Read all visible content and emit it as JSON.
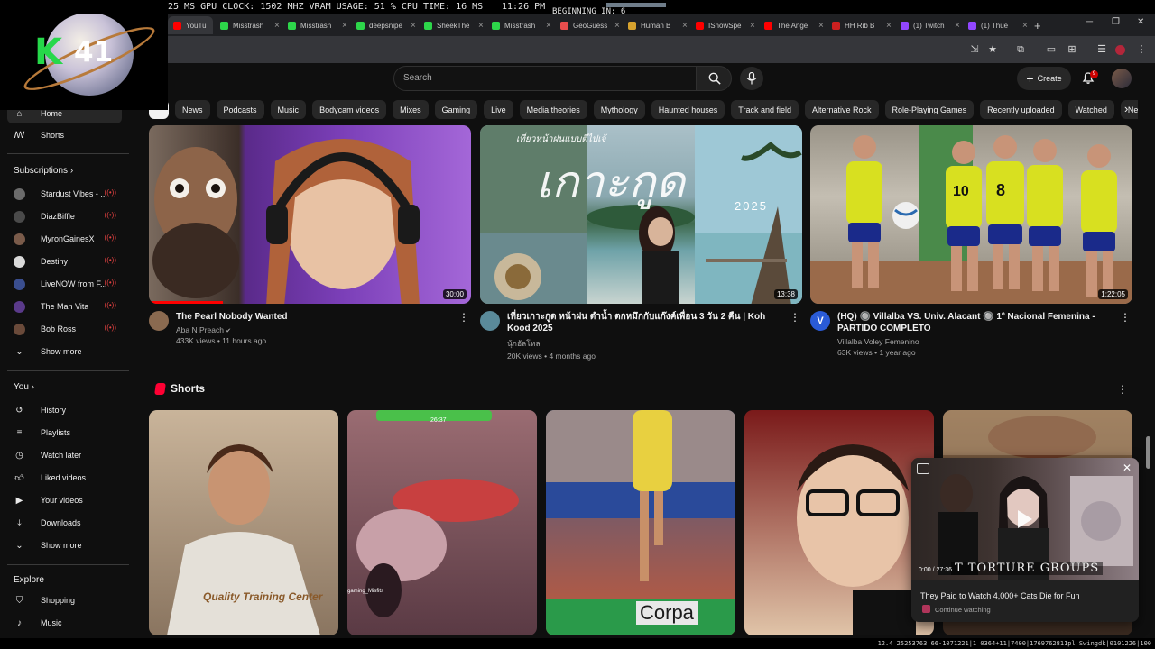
{
  "overlay": {
    "stats": "25 MS  GPU CLOCK: 1502 MHZ  VRAM USAGE: 51 %  CPU TIME: 16 MS",
    "clock": "11:26 PM",
    "beginning": "BEGINNING IN: 6",
    "badge_number": "41",
    "footer": "12.4 25253763|66-1071221|1 0364+11|7400|1769762811pl Swingdk|0101226|100"
  },
  "browser": {
    "tabs": [
      {
        "label": "YouTu",
        "color": "#ff0000",
        "active": true
      },
      {
        "label": "Misstrash",
        "color": "#2dd64a"
      },
      {
        "label": "Misstrash",
        "color": "#2dd64a"
      },
      {
        "label": "deepsnipe",
        "color": "#2dd64a"
      },
      {
        "label": "SheekThe",
        "color": "#2dd64a"
      },
      {
        "label": "Misstrash",
        "color": "#2dd64a"
      },
      {
        "label": "GeoGuess",
        "color": "#e84d4d"
      },
      {
        "label": "Human B",
        "color": "#d6a22e"
      },
      {
        "label": "IShowSpe",
        "color": "#ff0000"
      },
      {
        "label": "The Ange",
        "color": "#ff0000"
      },
      {
        "label": "HH Rib B",
        "color": "#cc2020"
      },
      {
        "label": "(1) Twitch",
        "color": "#9146ff"
      },
      {
        "label": "(1) Thue",
        "color": "#9146ff"
      }
    ],
    "new_tab": "+"
  },
  "header": {
    "search_placeholder": "Search",
    "create_label": "Create",
    "notification_count": "9"
  },
  "chips": [
    "",
    "News",
    "Podcasts",
    "Music",
    "Bodycam videos",
    "Mixes",
    "Gaming",
    "Live",
    "Media theories",
    "Mythology",
    "Haunted houses",
    "Track and field",
    "Alternative Rock",
    "Role-Playing Games",
    "Recently uploaded",
    "Watched",
    "New"
  ],
  "sidebar": {
    "home": "Home",
    "shorts": "Shorts",
    "subscriptions_heading": "Subscriptions",
    "subscriptions": [
      {
        "name": "Stardust Vibes - ...",
        "color": "#6b6b6b"
      },
      {
        "name": "DiazBiffle",
        "color": "#4a4a4a"
      },
      {
        "name": "MyronGainesX",
        "color": "#7a5b4a"
      },
      {
        "name": "Destiny",
        "color": "#d9d9d9"
      },
      {
        "name": "LiveNOW from F...",
        "color": "#3a4e8f"
      },
      {
        "name": "The Man Vita",
        "color": "#5a3a8a"
      },
      {
        "name": "Bob Ross",
        "color": "#6a4a3a"
      }
    ],
    "show_more": "Show more",
    "you_heading": "You",
    "you_items": [
      {
        "label": "History",
        "icon": "history-icon"
      },
      {
        "label": "Playlists",
        "icon": "playlists-icon"
      },
      {
        "label": "Watch later",
        "icon": "clock-icon"
      },
      {
        "label": "Liked videos",
        "icon": "thumbs-up-icon"
      },
      {
        "label": "Your videos",
        "icon": "play-icon"
      },
      {
        "label": "Downloads",
        "icon": "download-icon"
      }
    ],
    "show_more_2": "Show more",
    "explore_heading": "Explore",
    "explore_items": [
      {
        "label": "Shopping",
        "icon": "shopping-bag-icon"
      },
      {
        "label": "Music",
        "icon": "music-note-icon"
      }
    ]
  },
  "videos": [
    {
      "title": "The Pearl Nobody Wanted",
      "channel": "Aba N Preach",
      "verified": "✔",
      "stats": "433K views • 11 hours ago",
      "duration": "30:00",
      "progress_fraction": 0.23,
      "avatar_color": "#8a6a50"
    },
    {
      "title": "เที่ยวเกาะกูด หน้าฝน ตำน้ำ ตกหมึกกับแก๊งค์เพื่อน 3 วัน 2 คืน | Koh Kood 2025",
      "channel": "นุ้กอัลโหล",
      "stats": "20K views • 4 months ago",
      "duration": "13:38",
      "overlay_text": "เกาะกูด",
      "overlay_sub": "เที่ยวหน้าฝนแบบตีไปเจ้",
      "overlay_year": "2025",
      "avatar_color": "#5a8a9a"
    },
    {
      "title": "(HQ) 🔘 Villalba VS. Univ. Alacant 🔘 1º Nacional Femenina - PARTIDO COMPLETO",
      "channel": "Villalba Voley Femenino",
      "stats": "63K views • 1 year ago",
      "duration": "1:22:05",
      "avatar_letter": "V",
      "avatar_color": "#2a5bd7"
    }
  ],
  "shorts": {
    "heading": "Shorts",
    "items": [
      {
        "caption": "Quality Training Center",
        "colors": [
          "#c9b49a",
          "#8a7560"
        ]
      },
      {
        "caption": "gaming_Misfits",
        "time": "26:37",
        "colors": [
          "#9a6c72",
          "#5a3a44"
        ]
      },
      {
        "caption": "Corpa",
        "colors": [
          "#3e5a8a",
          "#c45a3a"
        ]
      },
      {
        "caption": "",
        "colors": [
          "#7a1a1a",
          "#e0c4a8"
        ]
      },
      {
        "caption": "",
        "colors": [
          "#8a6a4a",
          "#3a2a20"
        ]
      }
    ]
  },
  "miniplayer": {
    "title": "They Paid to Watch 4,000+ Cats Die for Fun",
    "status": "Continue watching",
    "time": "0:00 / 27:36",
    "overlay_text": "T TORTURE GROUPS"
  }
}
